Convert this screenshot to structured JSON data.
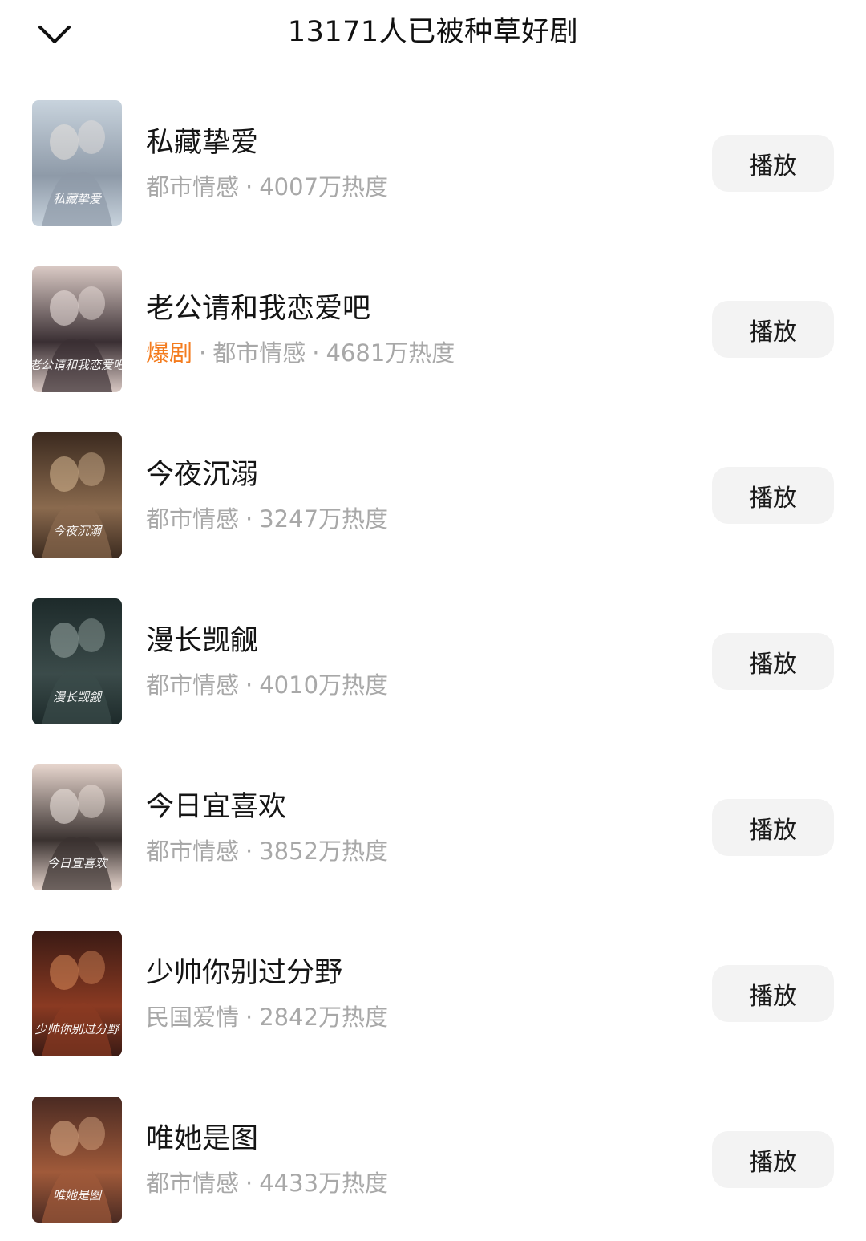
{
  "header": {
    "title": "13171人已被种草好剧",
    "back_icon": "chevron-down-icon"
  },
  "dramas": [
    {
      "title": "私藏挚爱",
      "badge": "",
      "genre": "都市情感",
      "heat": "4007万热度",
      "poster_text": "私藏挚爱",
      "colors": [
        "#c8d3dd",
        "#8e9aa8",
        "#e8e2dd"
      ],
      "action": "播放"
    },
    {
      "title": "老公请和我恋爱吧",
      "badge": "爆剧",
      "genre": "都市情感",
      "heat": "4681万热度",
      "poster_text": "老公请和我恋爱吧",
      "colors": [
        "#d9c9c4",
        "#3a2f33",
        "#f1e6e2"
      ],
      "action": "播放"
    },
    {
      "title": "今夜沉溺",
      "badge": "",
      "genre": "都市情感",
      "heat": "3247万热度",
      "poster_text": "今夜沉溺",
      "colors": [
        "#3b2a1f",
        "#8a6a4e",
        "#d8b994"
      ],
      "action": "播放"
    },
    {
      "title": "漫长觊觎",
      "badge": "",
      "genre": "都市情感",
      "heat": "4010万热度",
      "poster_text": "漫长觊觎",
      "colors": [
        "#1d2a2a",
        "#3b4b4a",
        "#9aa9a5"
      ],
      "action": "播放"
    },
    {
      "title": "今日宜喜欢",
      "badge": "",
      "genre": "都市情感",
      "heat": "3852万热度",
      "poster_text": "今日宜喜欢",
      "colors": [
        "#e6d5cd",
        "#3a3230",
        "#f3e9e3"
      ],
      "action": "播放"
    },
    {
      "title": "少帅你别过分野",
      "badge": "",
      "genre": "民国爱情",
      "heat": "2842万热度",
      "poster_text": "少帅你别过分野",
      "colors": [
        "#3a1a14",
        "#8a3a22",
        "#d88a5a"
      ],
      "action": "播放"
    },
    {
      "title": "唯她是图",
      "badge": "",
      "genre": "都市情感",
      "heat": "4433万热度",
      "poster_text": "唯她是图",
      "colors": [
        "#4a2a22",
        "#a05a3a",
        "#e0b08a"
      ],
      "action": "播放"
    }
  ]
}
